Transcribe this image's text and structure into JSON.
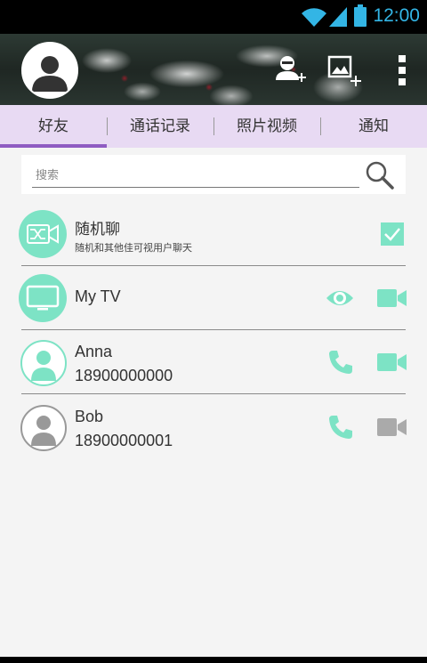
{
  "statusbar": {
    "time": "12:00"
  },
  "header": {
    "icons": [
      "avatar-icon",
      "add-friend-icon",
      "add-photo-icon",
      "more-icon"
    ]
  },
  "tabs": [
    {
      "label": "好友",
      "active": true
    },
    {
      "label": "通话记录",
      "active": false
    },
    {
      "label": "照片视频",
      "active": false
    },
    {
      "label": "通知",
      "active": false
    }
  ],
  "search": {
    "placeholder": "搜索"
  },
  "contacts": [
    {
      "name": "随机聊",
      "subtitle": "随机和其他佳可视用户聊天",
      "checked": true
    },
    {
      "name": "My TV"
    },
    {
      "name": "Anna",
      "number": "18900000000"
    },
    {
      "name": "Bob",
      "number": "18900000001"
    }
  ],
  "colors": {
    "accent": "#7de3c5",
    "tab_bg": "#e8daf3",
    "tab_indicator": "#8f5cc2",
    "status": "#33b5e5"
  }
}
